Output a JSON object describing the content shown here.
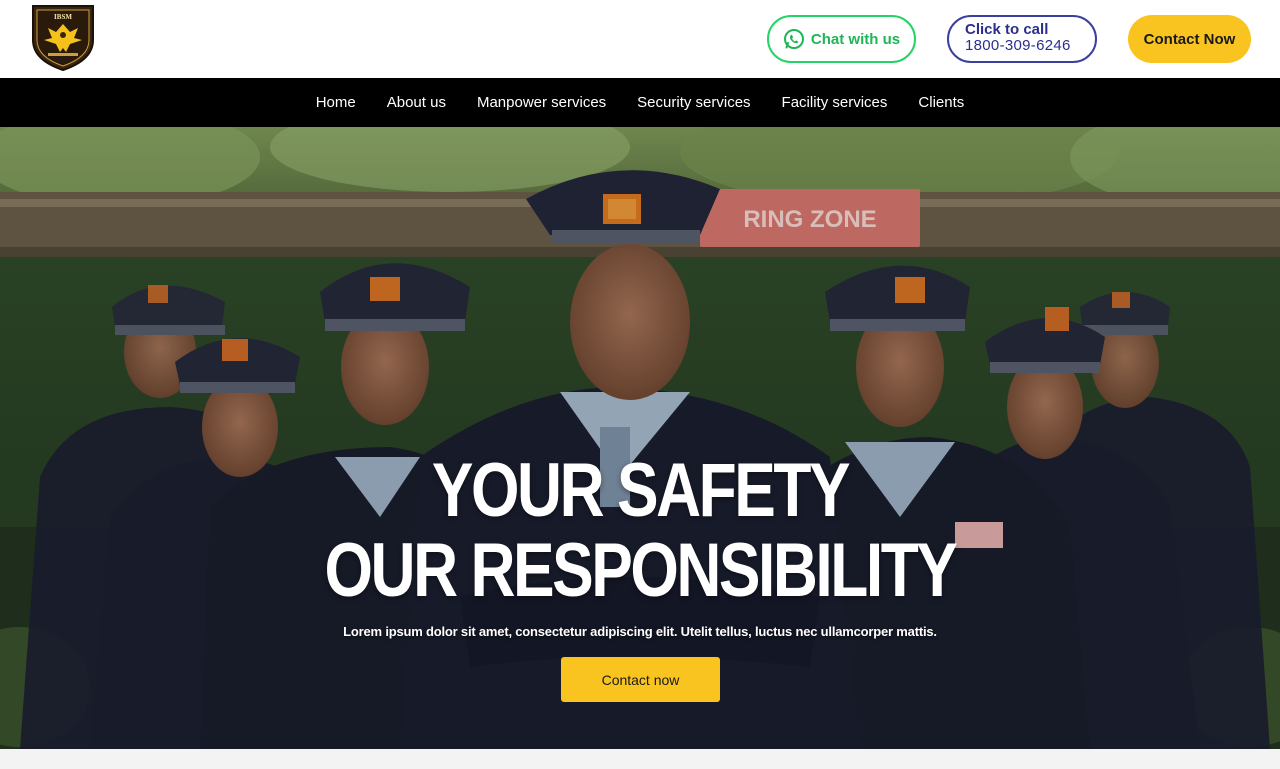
{
  "header": {
    "logo_text": "IBSM",
    "chat_label": "Chat with us",
    "call_label": "Click to call",
    "call_number": "1800-309-6246",
    "contact_label": "Contact Now"
  },
  "nav": {
    "items": [
      {
        "label": "Home"
      },
      {
        "label": "About us"
      },
      {
        "label": "Manpower services"
      },
      {
        "label": "Security services"
      },
      {
        "label": "Facility services"
      },
      {
        "label": "Clients"
      }
    ]
  },
  "hero": {
    "headline_line1": "YOUR SAFETY",
    "headline_line2": "OUR RESPONSIBILITY",
    "subtext": "Lorem ipsum dolor sit amet, consectetur adipiscing elit. Utelit tellus, luctus nec ullamcorper mattis.",
    "button_label": "Contact now",
    "background_sign_text": "RING ZONE"
  },
  "colors": {
    "accent_yellow": "#f9c420",
    "whatsapp_green": "#25d366",
    "call_blue": "#2a2f8c",
    "nav_bg": "#000000"
  },
  "icons": {
    "chat": "whatsapp-icon",
    "logo": "eagle-shield-logo"
  }
}
